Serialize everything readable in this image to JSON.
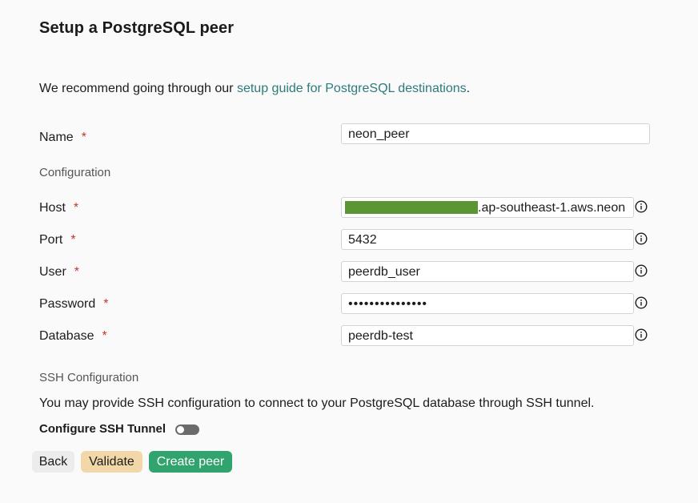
{
  "page": {
    "title": "Setup a PostgreSQL peer"
  },
  "intro": {
    "prefix": "We recommend going through our ",
    "link": "setup guide for PostgreSQL destinations",
    "suffix": "."
  },
  "required_marker": "*",
  "fields": {
    "name": {
      "label": "Name",
      "value": "neon_peer"
    },
    "config_heading": "Configuration",
    "host": {
      "label": "Host",
      "value": ".ap-southeast-1.aws.neon"
    },
    "port": {
      "label": "Port",
      "value": "5432"
    },
    "user": {
      "label": "User",
      "value": "peerdb_user"
    },
    "password": {
      "label": "Password",
      "value": "•••••••••••••••"
    },
    "database": {
      "label": "Database",
      "value": "peerdb-test"
    }
  },
  "ssh": {
    "heading": "SSH Configuration",
    "description": "You may provide SSH configuration to connect to your PostgreSQL database through SSH tunnel.",
    "toggle_label": "Configure SSH Tunnel",
    "toggle_on": false
  },
  "buttons": {
    "back": "Back",
    "validate": "Validate",
    "create": "Create peer"
  },
  "colors": {
    "link": "#2c7a7b",
    "required": "#c0392b",
    "validate_bg": "#f2d8a8",
    "create_bg": "#30a46c",
    "host_redaction": "#5a9634"
  },
  "icons": {
    "info": "info-circle-icon"
  }
}
